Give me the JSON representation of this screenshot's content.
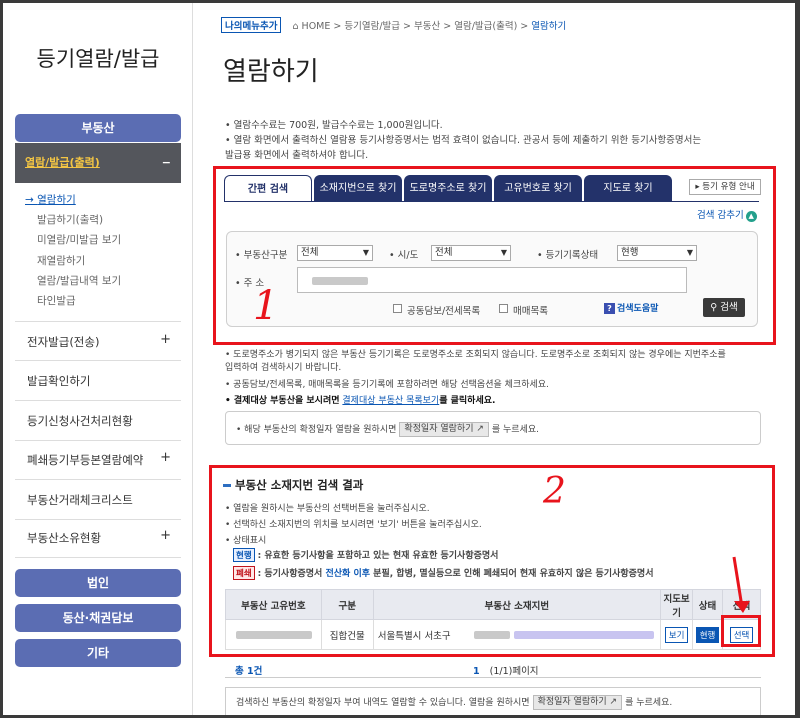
{
  "sidebar": {
    "title": "등기열람/발급",
    "top_pill": "부동산",
    "active_section": "열람/발급(출력)",
    "active_toggle": "−",
    "sub_items": [
      "열람하기",
      "발급하기(출력)",
      "미열람/미발급 보기",
      "재열람하기",
      "열람/발급내역 보기",
      "타인발급"
    ],
    "rows": [
      {
        "label": "전자발급(전송)",
        "toggle": "+"
      },
      {
        "label": "발급확인하기",
        "toggle": ""
      },
      {
        "label": "등기신청사건처리현황",
        "toggle": ""
      },
      {
        "label": "폐쇄등기부등본열람예약",
        "toggle": "+"
      },
      {
        "label": "부동산거래체크리스트",
        "toggle": ""
      },
      {
        "label": "부동산소유현황",
        "toggle": "+"
      }
    ],
    "bottom_pills": [
      "법인",
      "동산·채권담보",
      "기타"
    ]
  },
  "breadcrumb": {
    "my_menu": "나의메뉴추가",
    "items": "HOME > 등기열람/발급 > 부동산 > 열람/발급(출력) >",
    "current": "열람하기"
  },
  "page_title": "열람하기",
  "notices": [
    "• 열람수수료는 700원, 발급수수료는 1,000원입니다.",
    "• 열람 화면에서 출력하신 열람용 등기사항증명서는 법적 효력이 없습니다. 관공서 등에 제출하기 위한 등기사항증명서는",
    "  발급용 화면에서 출력하셔야 합니다."
  ],
  "tabs": [
    "간편 검색",
    "소재지번으로 찾기",
    "도로명주소로 찾기",
    "고유번호로 찾기",
    "지도로 찾기"
  ],
  "guide_button": "▸ 등기 유형 안내",
  "fold_label": "검색 감추기",
  "search": {
    "type_label": "• 부동산구분",
    "type_value": "전체",
    "region_label": "• 시/도",
    "region_value": "전체",
    "status_label": "• 등기기록상태",
    "status_value": "현행",
    "addr_label": "• 주 소",
    "chk1": "공동담보/전세목록",
    "chk2": "매매목록",
    "help": "검색도움말",
    "search_btn": "검색"
  },
  "annot1": "1",
  "annot2": "2",
  "info_lines": [
    "• 도로명주소가 병기되지 않은 부동산 등기기록은 도로명주소로 조회되지 않습니다. 도로명주소로 조회되지 않는 경우에는 지번주소를",
    "  입력하여 검색하시기 바랍니다.",
    "• 공동담보/전세목록, 매매목록을 등기기록에 포함하려면 해당 선택옵션을 체크하세요."
  ],
  "info_bold": "• 결제대상 부동산을 보시려면",
  "info_link": "결제대상 부동산 목록보기",
  "info_tail": "를 클릭하세요.",
  "infobox": {
    "pre": "• 해당 부동산의 확정일자 열람을 원하시면",
    "btn": "확정일자 열람하기 ↗",
    "post": "를 누르세요."
  },
  "result": {
    "title": "부동산 소재지번 검색 결과",
    "lines": [
      "• 열람을 원하시는 부동산의 선택버튼을 눌러주십시오.",
      "• 선택하신 소재지번의 위치를 보시려면 '보기' 버튼을 눌러주십시오.",
      "• 상태표시"
    ],
    "tag1": "현행",
    "tag1_text": ": 유효한 등기사항을 포함하고 있는 현재 유효한 등기사항증명서",
    "tag2": "폐쇄",
    "tag2_pre": ": 등기사항증명서",
    "tag2_mid": "전산화 이후",
    "tag2_post": "분필, 합병, 멸실등으로 인해 폐쇄되어 현재 유효하지 않은 등기사항증명서",
    "headers": [
      "부동산 고유번호",
      "구분",
      "부동산 소재지번",
      "지도보기",
      "상태",
      "선택"
    ],
    "row": {
      "kind": "집합건물",
      "addr": "서울특별시 서초구",
      "map": "보기",
      "state": "현행",
      "select": "선택"
    }
  },
  "total": "총 1건",
  "pager": {
    "page": "1",
    "info": "(1/1)페이지"
  },
  "bottom": {
    "pre": "검색하신 부동산의 확정일자 부여 내역도 열람할 수 있습니다. 열람을 원하시면",
    "btn": "확정일자 열람하기 ↗",
    "post": "를 누르세요."
  }
}
